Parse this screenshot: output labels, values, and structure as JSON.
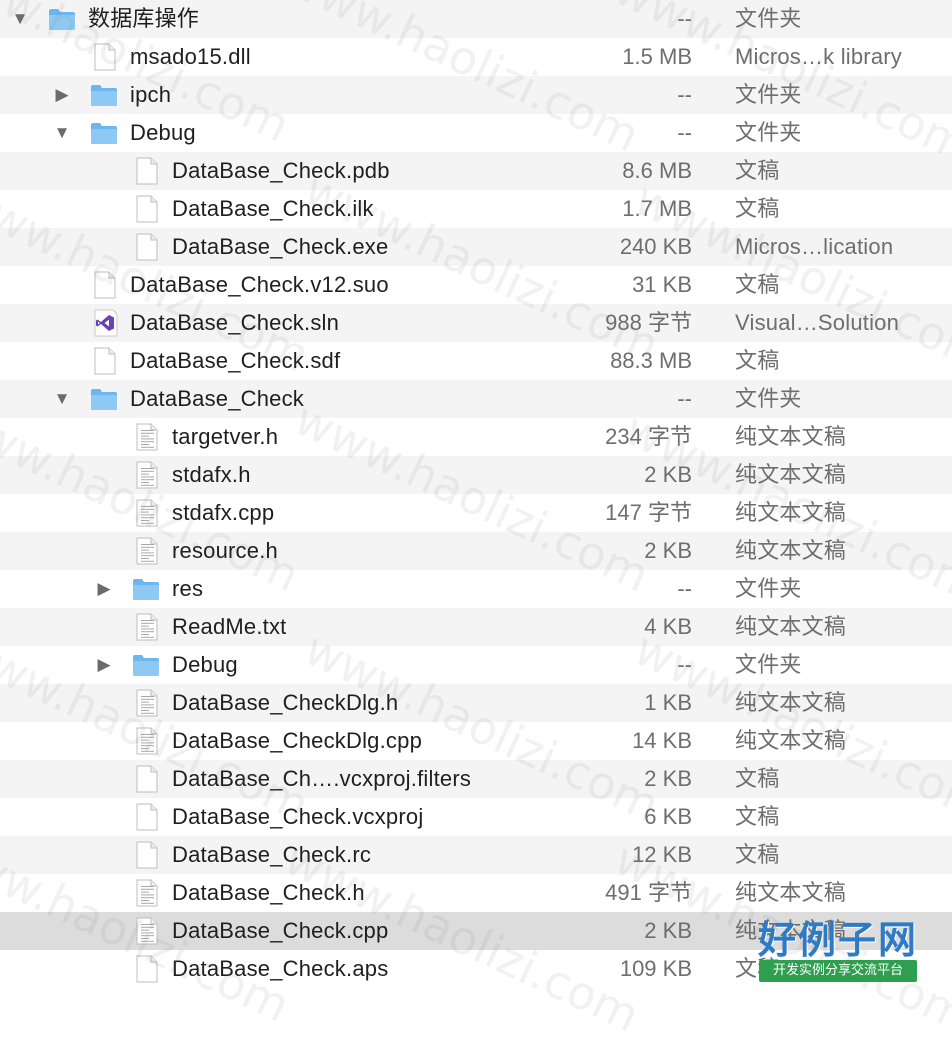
{
  "rows": [
    {
      "name": "数据库操作",
      "size": "--",
      "kind": "文件夹",
      "icon": "folder",
      "depth": 0,
      "expand": "down"
    },
    {
      "name": "msado15.dll",
      "size": "1.5 MB",
      "kind": "Micros…k library",
      "icon": "file",
      "depth": 1,
      "expand": ""
    },
    {
      "name": "ipch",
      "size": "--",
      "kind": "文件夹",
      "icon": "folder",
      "depth": 1,
      "expand": "right"
    },
    {
      "name": "Debug",
      "size": "--",
      "kind": "文件夹",
      "icon": "folder",
      "depth": 1,
      "expand": "down"
    },
    {
      "name": "DataBase_Check.pdb",
      "size": "8.6 MB",
      "kind": "文稿",
      "icon": "file",
      "depth": 2,
      "expand": ""
    },
    {
      "name": "DataBase_Check.ilk",
      "size": "1.7 MB",
      "kind": "文稿",
      "icon": "file",
      "depth": 2,
      "expand": ""
    },
    {
      "name": "DataBase_Check.exe",
      "size": "240 KB",
      "kind": "Micros…lication",
      "icon": "file",
      "depth": 2,
      "expand": ""
    },
    {
      "name": "DataBase_Check.v12.suo",
      "size": "31 KB",
      "kind": "文稿",
      "icon": "file",
      "depth": 1,
      "expand": ""
    },
    {
      "name": "DataBase_Check.sln",
      "size": "988 字节",
      "kind": "Visual…Solution",
      "icon": "vs",
      "depth": 1,
      "expand": ""
    },
    {
      "name": "DataBase_Check.sdf",
      "size": "88.3 MB",
      "kind": "文稿",
      "icon": "file",
      "depth": 1,
      "expand": ""
    },
    {
      "name": "DataBase_Check",
      "size": "--",
      "kind": "文件夹",
      "icon": "folder",
      "depth": 1,
      "expand": "down"
    },
    {
      "name": "targetver.h",
      "size": "234 字节",
      "kind": "纯文本文稿",
      "icon": "text",
      "depth": 2,
      "expand": ""
    },
    {
      "name": "stdafx.h",
      "size": "2 KB",
      "kind": "纯文本文稿",
      "icon": "text",
      "depth": 2,
      "expand": ""
    },
    {
      "name": "stdafx.cpp",
      "size": "147 字节",
      "kind": "纯文本文稿",
      "icon": "text",
      "depth": 2,
      "expand": ""
    },
    {
      "name": "resource.h",
      "size": "2 KB",
      "kind": "纯文本文稿",
      "icon": "text",
      "depth": 2,
      "expand": ""
    },
    {
      "name": "res",
      "size": "--",
      "kind": "文件夹",
      "icon": "folder",
      "depth": 2,
      "expand": "right"
    },
    {
      "name": "ReadMe.txt",
      "size": "4 KB",
      "kind": "纯文本文稿",
      "icon": "text",
      "depth": 2,
      "expand": ""
    },
    {
      "name": "Debug",
      "size": "--",
      "kind": "文件夹",
      "icon": "folder",
      "depth": 2,
      "expand": "right"
    },
    {
      "name": "DataBase_CheckDlg.h",
      "size": "1 KB",
      "kind": "纯文本文稿",
      "icon": "text",
      "depth": 2,
      "expand": ""
    },
    {
      "name": "DataBase_CheckDlg.cpp",
      "size": "14 KB",
      "kind": "纯文本文稿",
      "icon": "text",
      "depth": 2,
      "expand": ""
    },
    {
      "name": "DataBase_Ch….vcxproj.filters",
      "size": "2 KB",
      "kind": "文稿",
      "icon": "file",
      "depth": 2,
      "expand": ""
    },
    {
      "name": "DataBase_Check.vcxproj",
      "size": "6 KB",
      "kind": "文稿",
      "icon": "file",
      "depth": 2,
      "expand": ""
    },
    {
      "name": "DataBase_Check.rc",
      "size": "12 KB",
      "kind": "文稿",
      "icon": "file",
      "depth": 2,
      "expand": ""
    },
    {
      "name": "DataBase_Check.h",
      "size": "491 字节",
      "kind": "纯文本文稿",
      "icon": "text",
      "depth": 2,
      "expand": ""
    },
    {
      "name": "DataBase_Check.cpp",
      "size": "2 KB",
      "kind": "纯文本文稿",
      "icon": "text",
      "depth": 2,
      "expand": "",
      "selected": true
    },
    {
      "name": "DataBase_Check.aps",
      "size": "109 KB",
      "kind": "文稿",
      "icon": "file",
      "depth": 2,
      "expand": ""
    }
  ],
  "watermark_text": "www.haolizi.com",
  "site_logo": {
    "title": "好例子网",
    "subtitle": "开发实例分享交流平台"
  },
  "colors": {
    "folder": "#6cb6ef",
    "folder_tab": "#8ec9f4",
    "vs_purple": "#6a3fb7",
    "stripe": "#f4f4f4",
    "selected": "#dcdcdc"
  }
}
